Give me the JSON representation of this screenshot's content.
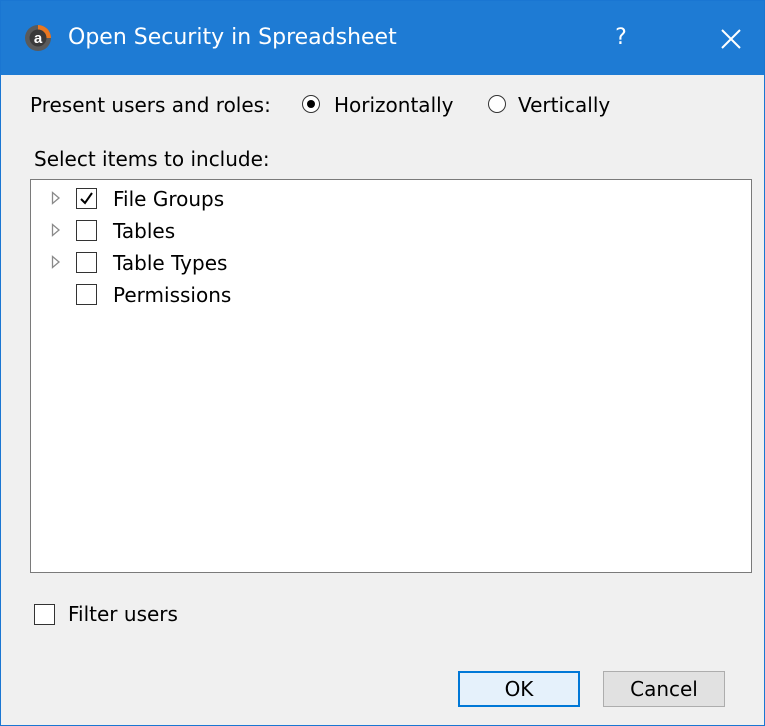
{
  "window": {
    "title": "Open Security in Spreadsheet",
    "app_icon_letter": "a",
    "help_label": "?",
    "close_icon": "close-icon"
  },
  "presentation": {
    "label": "Present users and roles:",
    "options": [
      {
        "label": "Horizontally",
        "selected": true
      },
      {
        "label": "Vertically",
        "selected": false
      }
    ]
  },
  "items": {
    "label": "Select items to include:",
    "tree": [
      {
        "label": "File Groups",
        "checked": true,
        "expandable": true
      },
      {
        "label": "Tables",
        "checked": false,
        "expandable": true
      },
      {
        "label": "Table Types",
        "checked": false,
        "expandable": true
      },
      {
        "label": "Permissions",
        "checked": false,
        "expandable": false
      }
    ]
  },
  "filter": {
    "label": "Filter users",
    "checked": false
  },
  "buttons": {
    "ok": "OK",
    "cancel": "Cancel"
  },
  "colors": {
    "titlebar": "#1e7bd4",
    "accent": "#0078d7",
    "window_bg": "#f0f0f0"
  }
}
